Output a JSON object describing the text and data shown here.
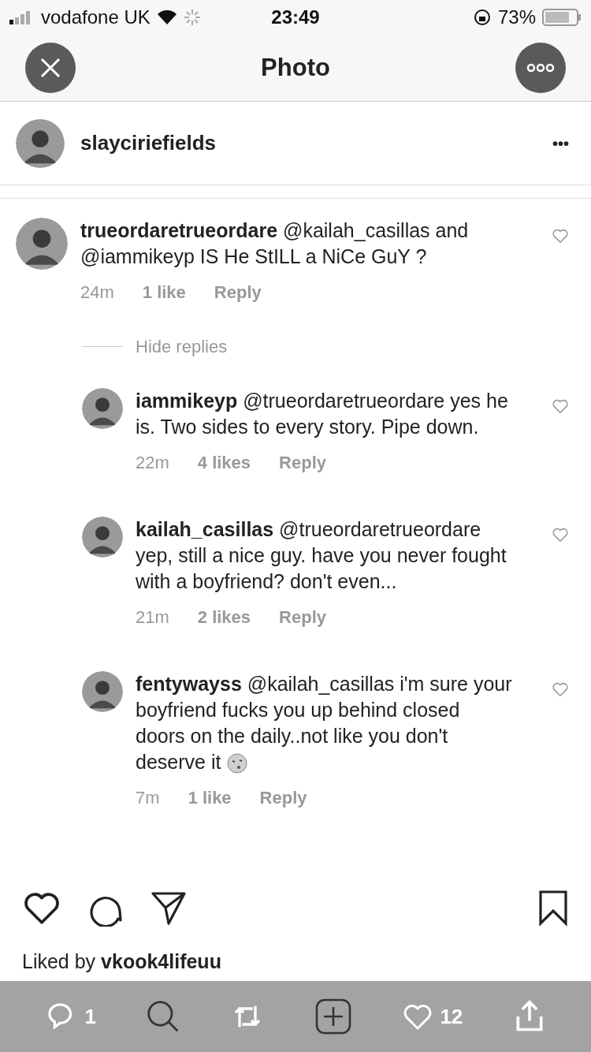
{
  "status_bar": {
    "carrier": "vodafone UK",
    "time": "23:49",
    "battery": "73%"
  },
  "nav": {
    "title": "Photo"
  },
  "post": {
    "username": "slayciriefields",
    "more": "•••"
  },
  "comments": [
    {
      "username": "trueordaretrueordare",
      "text": "@kailah_casillas and @iammikeyp IS He StILL a  NiCe GuY ?",
      "time": "24m",
      "likes": "1 like",
      "reply": "Reply",
      "liked": false,
      "hide_replies": "Hide replies",
      "children": [
        {
          "username": "iammikeyp",
          "text": "@trueordaretrueordare yes he is. Two sides to every story. Pipe down.",
          "time": "22m",
          "likes": "4 likes",
          "reply": "Reply",
          "liked": false,
          "emoji": false
        },
        {
          "username": "kailah_casillas",
          "text": "@trueordaretrueordare yep, still a nice guy. have you never fought with a boyfriend? don't even...",
          "time": "21m",
          "likes": "2 likes",
          "reply": "Reply",
          "liked": false,
          "emoji": false
        },
        {
          "username": "fentywayss",
          "text": "@kailah_casillas i'm sure your boyfriend fucks you up behind closed doors on the daily..not like you don't deserve it",
          "time": "7m",
          "likes": "1 like",
          "reply": "Reply",
          "liked": false,
          "emoji": true
        }
      ]
    }
  ],
  "liked_by": {
    "prefix": "Liked by",
    "user": "vkook4lifeuu"
  },
  "overlay_bar": {
    "replies": "1",
    "likes": "12"
  }
}
